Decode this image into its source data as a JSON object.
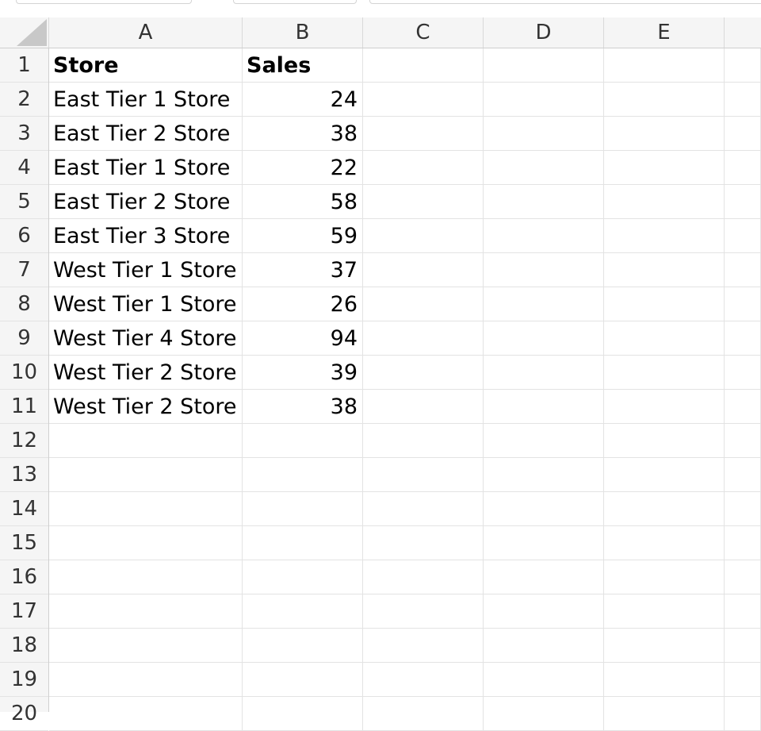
{
  "columns": [
    "A",
    "B",
    "C",
    "D",
    "E"
  ],
  "rows": [
    {
      "num": "1",
      "a": "Store",
      "b": "Sales"
    },
    {
      "num": "2",
      "a": "East Tier 1 Store",
      "b": "24"
    },
    {
      "num": "3",
      "a": "East Tier 2 Store",
      "b": "38"
    },
    {
      "num": "4",
      "a": "East Tier 1 Store",
      "b": "22"
    },
    {
      "num": "5",
      "a": "East Tier 2 Store",
      "b": "58"
    },
    {
      "num": "6",
      "a": "East Tier 3 Store",
      "b": "59"
    },
    {
      "num": "7",
      "a": "West Tier 1 Store",
      "b": "37"
    },
    {
      "num": "8",
      "a": "West Tier 1 Store",
      "b": "26"
    },
    {
      "num": "9",
      "a": "West Tier 4 Store",
      "b": "94"
    },
    {
      "num": "10",
      "a": "West Tier 2 Store",
      "b": "39"
    },
    {
      "num": "11",
      "a": "West Tier 2 Store",
      "b": "38"
    },
    {
      "num": "12",
      "a": "",
      "b": ""
    },
    {
      "num": "13",
      "a": "",
      "b": ""
    },
    {
      "num": "14",
      "a": "",
      "b": ""
    },
    {
      "num": "15",
      "a": "",
      "b": ""
    },
    {
      "num": "16",
      "a": "",
      "b": ""
    },
    {
      "num": "17",
      "a": "",
      "b": ""
    },
    {
      "num": "18",
      "a": "",
      "b": ""
    },
    {
      "num": "19",
      "a": "",
      "b": ""
    },
    {
      "num": "20",
      "a": "",
      "b": ""
    }
  ]
}
